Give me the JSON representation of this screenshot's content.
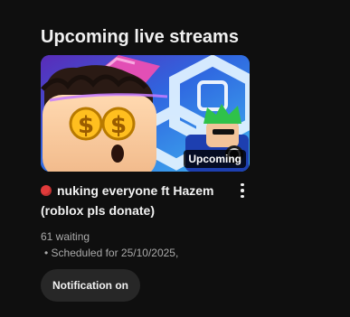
{
  "shelf": {
    "title": "Upcoming live streams"
  },
  "video": {
    "badge": "Upcoming",
    "title": "nuking everyone ft Hazem (roblox pls donate)",
    "live_indicator": "red-circle-icon",
    "menu_icon": "more-vertical-icon",
    "waiting": "61 waiting",
    "scheduled": "• Scheduled for 25/10/2025,",
    "notify_label": "Notification on"
  },
  "colors": {
    "background": "#0f0f0f",
    "text_primary": "#f1f1f1",
    "text_secondary": "#aaaaaa",
    "button_bg": "#272727",
    "live_dot": "#e23b3b"
  }
}
